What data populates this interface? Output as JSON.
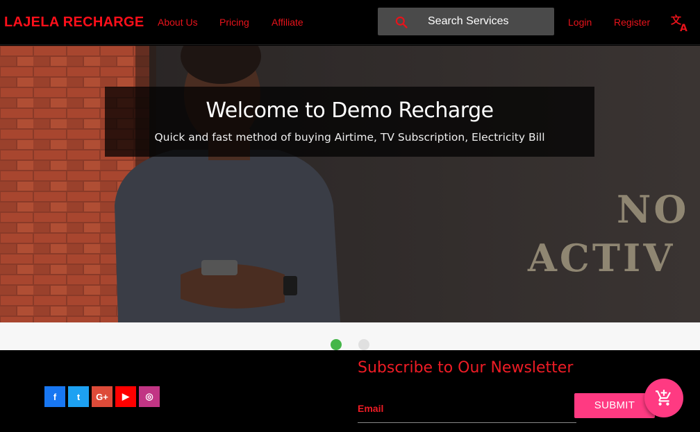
{
  "nav": {
    "brand": "LAJELA RECHARGE",
    "links": [
      "About Us",
      "Pricing",
      "Affiliate"
    ],
    "search_label": "Search Services",
    "login": "Login",
    "register": "Register",
    "translate_icon": "translate-icon"
  },
  "hero": {
    "title": "Welcome to Demo Recharge",
    "subtitle": "Quick and fast method of buying Airtime, TV Subscription, Electricity Bill",
    "slides": 2,
    "active_slide": 1
  },
  "footer": {
    "social": [
      {
        "name": "facebook",
        "glyph": "f",
        "color": "#1877f2"
      },
      {
        "name": "twitter",
        "glyph": "t",
        "color": "#1da1f2"
      },
      {
        "name": "google-plus",
        "glyph": "G+",
        "color": "#dd4b39"
      },
      {
        "name": "youtube",
        "glyph": "▶",
        "color": "#ff0000"
      },
      {
        "name": "instagram",
        "glyph": "◎",
        "color": "#c13584"
      }
    ],
    "newsletter_title": "Subscribe to Our Newsletter",
    "email_label": "Email",
    "submit": "SUBMIT"
  },
  "colors": {
    "brand": "#ff0f1a",
    "accent": "#ff3a82",
    "indicator_active": "#45b649"
  },
  "fab_icon": "add-shopping-cart-icon"
}
